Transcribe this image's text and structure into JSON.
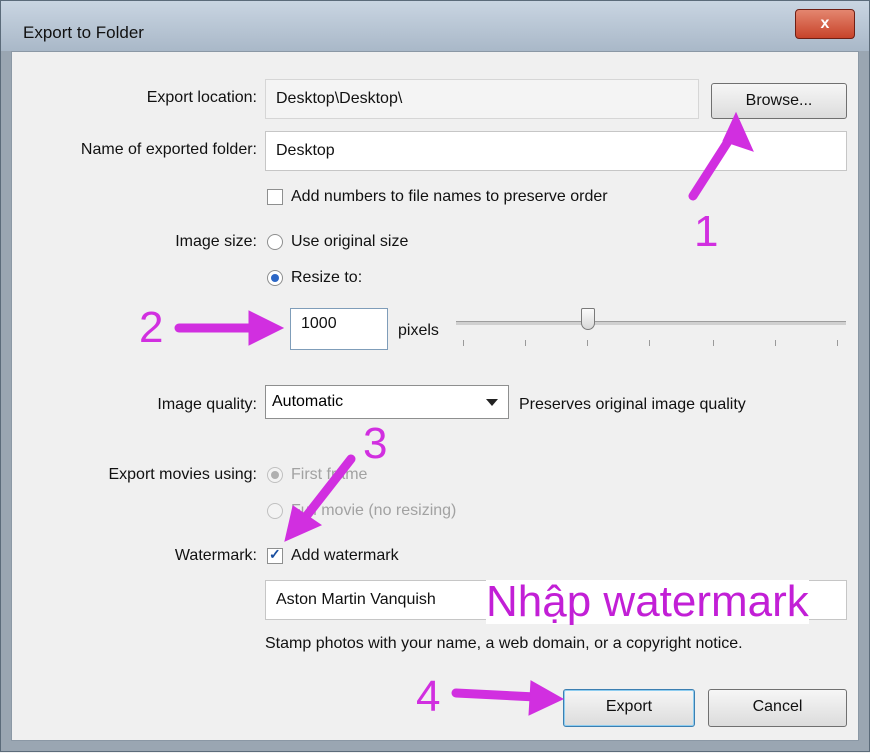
{
  "window": {
    "title": "Export to Folder",
    "close_label": "x"
  },
  "export_location": {
    "label": "Export location:",
    "value": "Desktop\\Desktop\\",
    "browse_label": "Browse..."
  },
  "folder_name": {
    "label": "Name of exported folder:",
    "value": "Desktop"
  },
  "add_numbers": {
    "label": "Add numbers to file names to preserve order",
    "checked": false
  },
  "image_size": {
    "label": "Image size:",
    "option_original": "Use original size",
    "option_resize": "Resize to:",
    "selected": "Resize to:",
    "pixels_value": "1000",
    "pixels_unit": "pixels",
    "slider_level": 0.31
  },
  "image_quality": {
    "label": "Image quality:",
    "selected": "Automatic",
    "note": "Preserves original image quality"
  },
  "export_movies": {
    "label": "Export movies using:",
    "option_first": "First frame",
    "option_full": "Full movie (no resizing)"
  },
  "watermark": {
    "label": "Watermark:",
    "checkbox_label": "Add watermark",
    "checked": true,
    "text": "Aston Martin Vanquish",
    "hint": "Stamp photos with your name, a web domain, or a copyright notice."
  },
  "buttons": {
    "export": "Export",
    "cancel": "Cancel"
  },
  "annotations": {
    "n1": "1",
    "n2": "2",
    "n3": "3",
    "n4": "4",
    "watermark_note": "Nhập watermark",
    "color": "#d12fe0"
  }
}
